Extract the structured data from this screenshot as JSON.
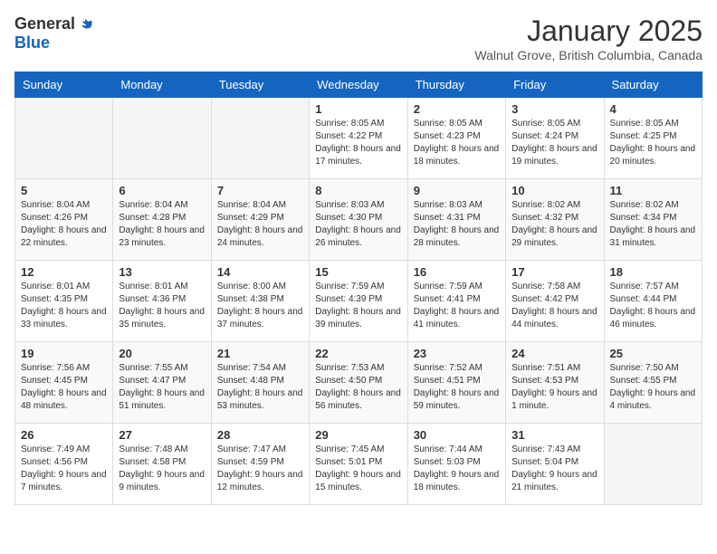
{
  "header": {
    "logo_general": "General",
    "logo_blue": "Blue",
    "month_title": "January 2025",
    "location": "Walnut Grove, British Columbia, Canada"
  },
  "days_of_week": [
    "Sunday",
    "Monday",
    "Tuesday",
    "Wednesday",
    "Thursday",
    "Friday",
    "Saturday"
  ],
  "weeks": [
    [
      {
        "day": "",
        "info": ""
      },
      {
        "day": "",
        "info": ""
      },
      {
        "day": "",
        "info": ""
      },
      {
        "day": "1",
        "info": "Sunrise: 8:05 AM\nSunset: 4:22 PM\nDaylight: 8 hours\nand 17 minutes."
      },
      {
        "day": "2",
        "info": "Sunrise: 8:05 AM\nSunset: 4:23 PM\nDaylight: 8 hours\nand 18 minutes."
      },
      {
        "day": "3",
        "info": "Sunrise: 8:05 AM\nSunset: 4:24 PM\nDaylight: 8 hours\nand 19 minutes."
      },
      {
        "day": "4",
        "info": "Sunrise: 8:05 AM\nSunset: 4:25 PM\nDaylight: 8 hours\nand 20 minutes."
      }
    ],
    [
      {
        "day": "5",
        "info": "Sunrise: 8:04 AM\nSunset: 4:26 PM\nDaylight: 8 hours\nand 22 minutes."
      },
      {
        "day": "6",
        "info": "Sunrise: 8:04 AM\nSunset: 4:28 PM\nDaylight: 8 hours\nand 23 minutes."
      },
      {
        "day": "7",
        "info": "Sunrise: 8:04 AM\nSunset: 4:29 PM\nDaylight: 8 hours\nand 24 minutes."
      },
      {
        "day": "8",
        "info": "Sunrise: 8:03 AM\nSunset: 4:30 PM\nDaylight: 8 hours\nand 26 minutes."
      },
      {
        "day": "9",
        "info": "Sunrise: 8:03 AM\nSunset: 4:31 PM\nDaylight: 8 hours\nand 28 minutes."
      },
      {
        "day": "10",
        "info": "Sunrise: 8:02 AM\nSunset: 4:32 PM\nDaylight: 8 hours\nand 29 minutes."
      },
      {
        "day": "11",
        "info": "Sunrise: 8:02 AM\nSunset: 4:34 PM\nDaylight: 8 hours\nand 31 minutes."
      }
    ],
    [
      {
        "day": "12",
        "info": "Sunrise: 8:01 AM\nSunset: 4:35 PM\nDaylight: 8 hours\nand 33 minutes."
      },
      {
        "day": "13",
        "info": "Sunrise: 8:01 AM\nSunset: 4:36 PM\nDaylight: 8 hours\nand 35 minutes."
      },
      {
        "day": "14",
        "info": "Sunrise: 8:00 AM\nSunset: 4:38 PM\nDaylight: 8 hours\nand 37 minutes."
      },
      {
        "day": "15",
        "info": "Sunrise: 7:59 AM\nSunset: 4:39 PM\nDaylight: 8 hours\nand 39 minutes."
      },
      {
        "day": "16",
        "info": "Sunrise: 7:59 AM\nSunset: 4:41 PM\nDaylight: 8 hours\nand 41 minutes."
      },
      {
        "day": "17",
        "info": "Sunrise: 7:58 AM\nSunset: 4:42 PM\nDaylight: 8 hours\nand 44 minutes."
      },
      {
        "day": "18",
        "info": "Sunrise: 7:57 AM\nSunset: 4:44 PM\nDaylight: 8 hours\nand 46 minutes."
      }
    ],
    [
      {
        "day": "19",
        "info": "Sunrise: 7:56 AM\nSunset: 4:45 PM\nDaylight: 8 hours\nand 48 minutes."
      },
      {
        "day": "20",
        "info": "Sunrise: 7:55 AM\nSunset: 4:47 PM\nDaylight: 8 hours\nand 51 minutes."
      },
      {
        "day": "21",
        "info": "Sunrise: 7:54 AM\nSunset: 4:48 PM\nDaylight: 8 hours\nand 53 minutes."
      },
      {
        "day": "22",
        "info": "Sunrise: 7:53 AM\nSunset: 4:50 PM\nDaylight: 8 hours\nand 56 minutes."
      },
      {
        "day": "23",
        "info": "Sunrise: 7:52 AM\nSunset: 4:51 PM\nDaylight: 8 hours\nand 59 minutes."
      },
      {
        "day": "24",
        "info": "Sunrise: 7:51 AM\nSunset: 4:53 PM\nDaylight: 9 hours\nand 1 minute."
      },
      {
        "day": "25",
        "info": "Sunrise: 7:50 AM\nSunset: 4:55 PM\nDaylight: 9 hours\nand 4 minutes."
      }
    ],
    [
      {
        "day": "26",
        "info": "Sunrise: 7:49 AM\nSunset: 4:56 PM\nDaylight: 9 hours\nand 7 minutes."
      },
      {
        "day": "27",
        "info": "Sunrise: 7:48 AM\nSunset: 4:58 PM\nDaylight: 9 hours\nand 9 minutes."
      },
      {
        "day": "28",
        "info": "Sunrise: 7:47 AM\nSunset: 4:59 PM\nDaylight: 9 hours\nand 12 minutes."
      },
      {
        "day": "29",
        "info": "Sunrise: 7:45 AM\nSunset: 5:01 PM\nDaylight: 9 hours\nand 15 minutes."
      },
      {
        "day": "30",
        "info": "Sunrise: 7:44 AM\nSunset: 5:03 PM\nDaylight: 9 hours\nand 18 minutes."
      },
      {
        "day": "31",
        "info": "Sunrise: 7:43 AM\nSunset: 5:04 PM\nDaylight: 9 hours\nand 21 minutes."
      },
      {
        "day": "",
        "info": ""
      }
    ]
  ]
}
